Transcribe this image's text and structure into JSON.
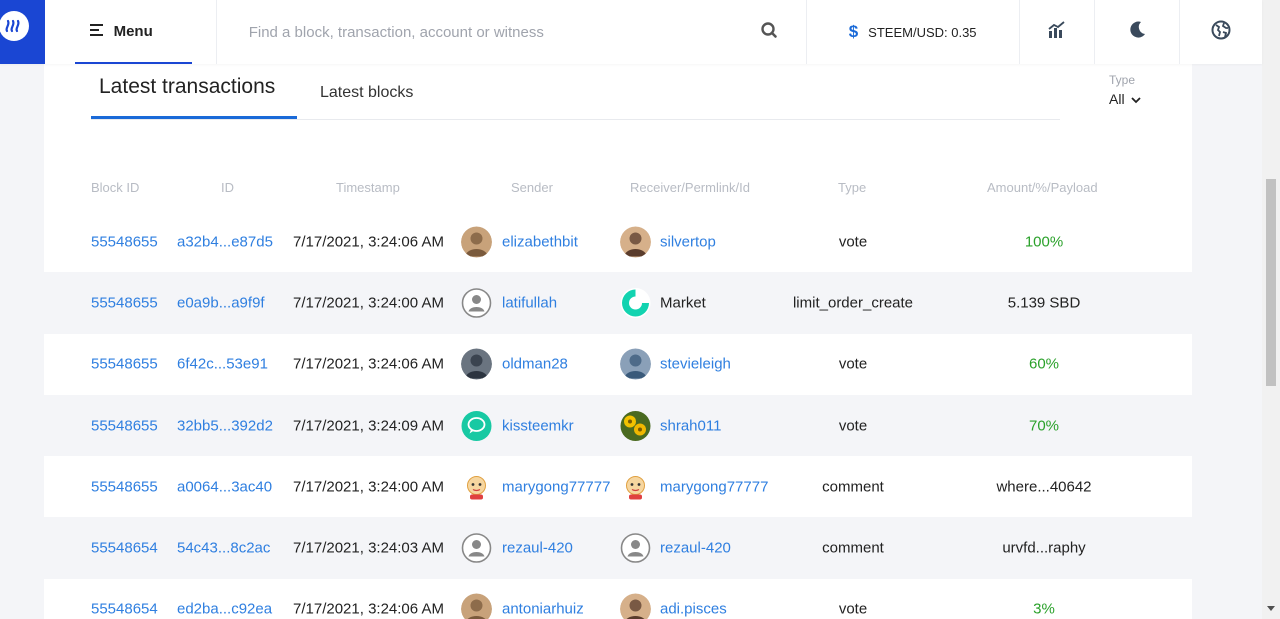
{
  "header": {
    "logo_icon": "steem-logo-icon",
    "menu_label": "Menu",
    "search_placeholder": "Find a block, transaction, account or witness",
    "price_label": "STEEM/USD: 0.35",
    "icons": [
      "search-icon",
      "chart-icon",
      "moon-icon",
      "globe-icon"
    ],
    "accent": "#1a46d3"
  },
  "tabs": {
    "active": "Latest transactions",
    "other": "Latest blocks"
  },
  "type_filter": {
    "label": "Type",
    "value": "All"
  },
  "table": {
    "columns": [
      "Block ID",
      "ID",
      "Timestamp",
      "Sender",
      "Receiver/Permlink/Id",
      "Type",
      "Amount/%/Payload"
    ],
    "rows": [
      {
        "block": "55548655",
        "id": "a32b4...e87d5",
        "timestamp": "7/17/2021, 3:24:06 AM",
        "sender": "elizabethbit",
        "sender_avatar": "photo-avatar",
        "receiver": "silvertop",
        "receiver_avatar": "photo-avatar",
        "receiver_link": true,
        "type": "vote",
        "amount": "100%",
        "amount_pct": true
      },
      {
        "block": "55548655",
        "id": "e0a9b...a9f9f",
        "timestamp": "7/17/2021, 3:24:00 AM",
        "sender": "latifullah",
        "sender_avatar": "default-user-avatar",
        "receiver": "Market",
        "receiver_avatar": "market-logo-icon",
        "receiver_link": false,
        "type": "limit_order_create",
        "amount": "5.139 SBD",
        "amount_pct": false
      },
      {
        "block": "55548655",
        "id": "6f42c...53e91",
        "timestamp": "7/17/2021, 3:24:06 AM",
        "sender": "oldman28",
        "sender_avatar": "photo-avatar",
        "receiver": "stevieleigh",
        "receiver_avatar": "photo-avatar",
        "receiver_link": true,
        "type": "vote",
        "amount": "60%",
        "amount_pct": true
      },
      {
        "block": "55548655",
        "id": "32bb5...392d2",
        "timestamp": "7/17/2021, 3:24:09 AM",
        "sender": "kissteemkr",
        "sender_avatar": "green-chat-avatar",
        "receiver": "shrah011",
        "receiver_avatar": "flower-avatar",
        "receiver_link": true,
        "type": "vote",
        "amount": "70%",
        "amount_pct": true
      },
      {
        "block": "55548655",
        "id": "a0064...3ac40",
        "timestamp": "7/17/2021, 3:24:00 AM",
        "sender": "marygong77777",
        "sender_avatar": "cartoon-avatar",
        "receiver": "marygong77777",
        "receiver_avatar": "cartoon-avatar",
        "receiver_link": true,
        "type": "comment",
        "amount": "where...40642",
        "amount_pct": false
      },
      {
        "block": "55548654",
        "id": "54c43...8c2ac",
        "timestamp": "7/17/2021, 3:24:03 AM",
        "sender": "rezaul-420",
        "sender_avatar": "default-user-avatar",
        "receiver": "rezaul-420",
        "receiver_avatar": "default-user-avatar",
        "receiver_link": true,
        "type": "comment",
        "amount": "urvfd...raphy",
        "amount_pct": false
      },
      {
        "block": "55548654",
        "id": "ed2ba...c92ea",
        "timestamp": "7/17/2021, 3:24:06 AM",
        "sender": "antoniarhuiz",
        "sender_avatar": "photo-avatar",
        "receiver": "adi.pisces",
        "receiver_avatar": "photo-avatar",
        "receiver_link": true,
        "type": "vote",
        "amount": "3%",
        "amount_pct": true
      }
    ]
  },
  "colors": {
    "link": "#2f7fe0",
    "percent": "#2aa12a",
    "alt_row": "#f4f5f8"
  }
}
